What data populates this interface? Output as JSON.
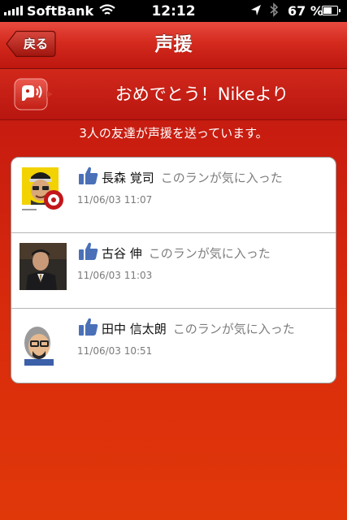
{
  "status_bar": {
    "carrier": "SoftBank",
    "time": "12:12",
    "battery_percent": "67 %",
    "battery_level": 0.67
  },
  "nav": {
    "back_label": "戻る",
    "title": "声援"
  },
  "banner": {
    "text": "おめでとう！Nikeより"
  },
  "subheading": "3人の友達が声援を送っています。",
  "cheers": [
    {
      "name": "長森 覚司",
      "action": "このランが気に入った",
      "timestamp": "11/06/03 11:07"
    },
    {
      "name": "古谷 伸",
      "action": "このランが気に入った",
      "timestamp": "11/06/03 11:03"
    },
    {
      "name": "田中 信太朗",
      "action": "このランが気に入った",
      "timestamp": "11/06/03 10:51"
    }
  ],
  "icons": {
    "signal": "signal-bars-icon",
    "wifi": "wifi-icon",
    "location": "location-arrow-icon",
    "bluetooth": "bluetooth-icon",
    "battery": "battery-icon",
    "cheer": "speaker-cheer-icon",
    "like": "thumbs-up-icon"
  },
  "colors": {
    "nav_red": "#d42a1e",
    "background_red": "#d82a0c",
    "like_blue": "#4a70b8"
  }
}
